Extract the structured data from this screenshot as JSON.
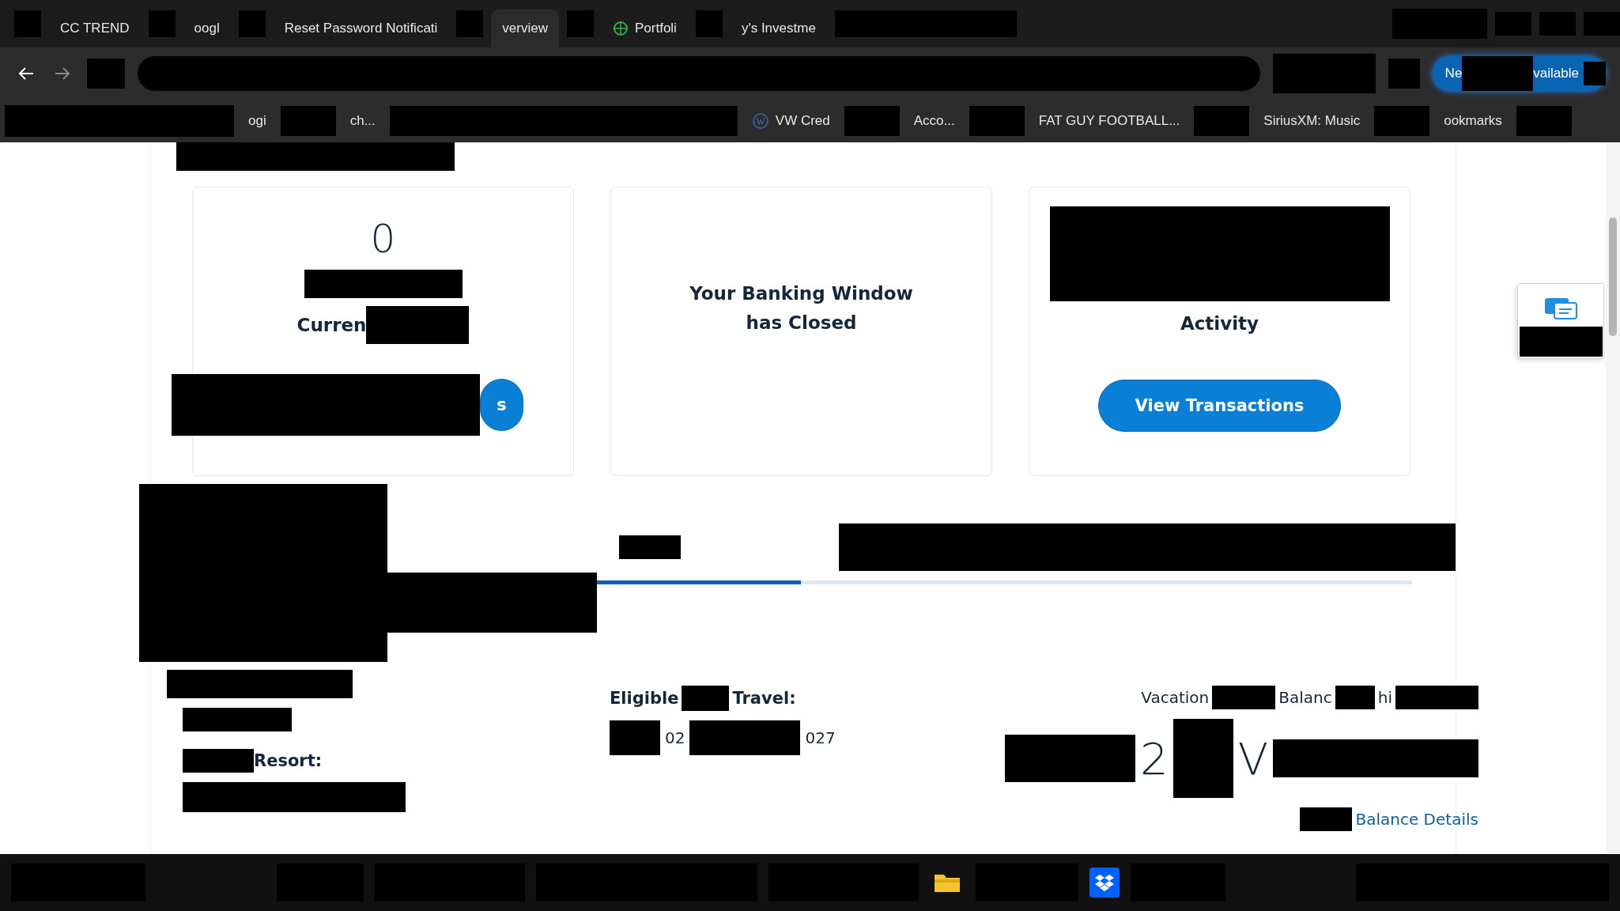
{
  "browser": {
    "tabs": [
      {
        "label": "CC TREND",
        "selected": false,
        "kind": "text"
      },
      {
        "label": "oogl",
        "selected": false,
        "kind": "text"
      },
      {
        "label": "Reset Password Notificati",
        "selected": false,
        "kind": "text"
      },
      {
        "label": "verview",
        "selected": true,
        "kind": "text"
      },
      {
        "label": "Portfoli",
        "selected": false,
        "kind": "icon"
      },
      {
        "label": "y's Investme",
        "selected": false,
        "kind": "text"
      }
    ],
    "update_button": {
      "parts": [
        "Ne",
        "vailable"
      ]
    },
    "bookmarks": [
      {
        "label": "ogi",
        "kind": "text"
      },
      {
        "label": "ch...",
        "kind": "text"
      },
      {
        "label": "VW Cred",
        "kind": "icon"
      },
      {
        "label": "Acco...",
        "kind": "text"
      },
      {
        "label": "FAT GUY FOOTBALL...",
        "kind": "text"
      },
      {
        "label": "SiriusXM: Music",
        "kind": "text"
      },
      {
        "label": "ookmarks",
        "kind": "text"
      }
    ]
  },
  "cards": [
    {
      "kind": "count",
      "value": "0",
      "label": "Curren",
      "button": "s"
    },
    {
      "kind": "message",
      "message": "Your Banking Window has Closed"
    },
    {
      "kind": "activity",
      "label": "Activity",
      "button": "View Transactions"
    }
  ],
  "progress": {
    "level": 0.25
  },
  "details": {
    "resort_label": "Resort:",
    "travel_label_parts": [
      "Eligible",
      "Travel:"
    ],
    "travel_dates": [
      "02",
      "027"
    ],
    "balance_label_parts": [
      "Vacation",
      "Balanc",
      "hi"
    ],
    "balance_value_parts": [
      "2",
      "V"
    ],
    "balance_link": "Balance Details"
  }
}
